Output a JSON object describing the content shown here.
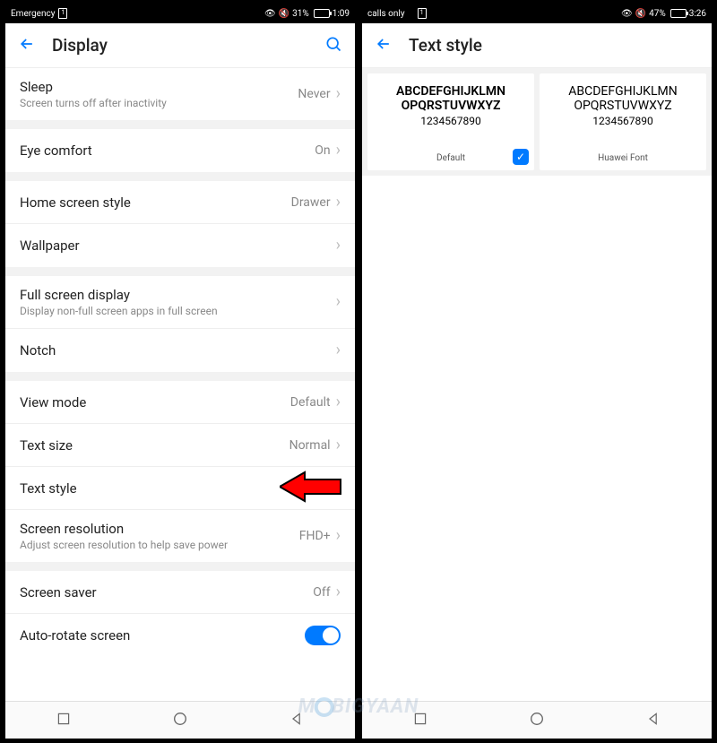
{
  "left": {
    "status": {
      "label": "Emergency",
      "battery_pct": "31%",
      "battery_fill": 31,
      "time": "1:09"
    },
    "header": {
      "title": "Display"
    },
    "groups": [
      {
        "items": [
          {
            "title": "Sleep",
            "sub": "Screen turns off after inactivity",
            "value": "Never",
            "chevron": true
          }
        ]
      },
      {
        "items": [
          {
            "title": "Eye comfort",
            "value": "On",
            "chevron": true
          }
        ]
      },
      {
        "items": [
          {
            "title": "Home screen style",
            "value": "Drawer",
            "chevron": true
          },
          {
            "title": "Wallpaper",
            "chevron": true
          }
        ]
      },
      {
        "items": [
          {
            "title": "Full screen display",
            "sub": "Display non-full screen apps in full screen",
            "chevron": true
          },
          {
            "title": "Notch",
            "chevron": true
          }
        ]
      },
      {
        "items": [
          {
            "title": "View mode",
            "value": "Default",
            "chevron": true
          },
          {
            "title": "Text size",
            "value": "Normal",
            "chevron": true
          },
          {
            "title": "Text style",
            "highlight_arrow": true
          },
          {
            "title": "Screen resolution",
            "sub": "Adjust screen resolution to help save power",
            "value": "FHD+",
            "chevron": true
          }
        ]
      },
      {
        "items": [
          {
            "title": "Screen saver",
            "value": "Off",
            "chevron": true
          },
          {
            "title": "Auto-rotate screen",
            "toggle": true
          }
        ]
      }
    ]
  },
  "right": {
    "status": {
      "label": "calls only",
      "battery_pct": "47%",
      "battery_fill": 47,
      "time": "3:26"
    },
    "header": {
      "title": "Text style"
    },
    "fonts": [
      {
        "line1": "ABCDEFGHIJKLMN",
        "line2": "OPQRSTUVWXYZ",
        "nums": "1234567890",
        "name": "Default",
        "selected": true,
        "bold": true
      },
      {
        "line1": "ABCDEFGHIJKLMN",
        "line2": "OPQRSTUVWXYZ",
        "nums": "1234567890",
        "name": "Huawei Font",
        "selected": false,
        "bold": false
      }
    ]
  },
  "watermark": {
    "pre": "M",
    "post": "BIGYAAN"
  }
}
